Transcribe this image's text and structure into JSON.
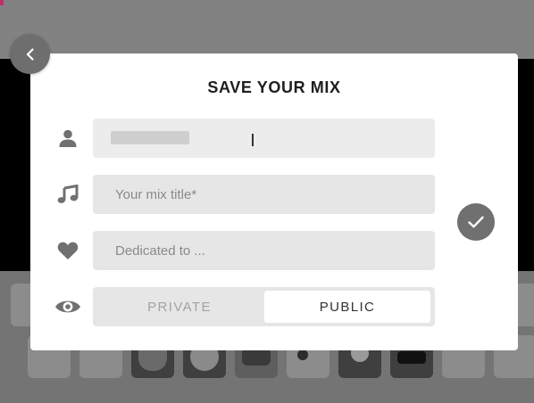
{
  "modal": {
    "title": "SAVE YOUR MIX",
    "name_field": {
      "value": ""
    },
    "title_field": {
      "placeholder": "Your mix title*"
    },
    "dedicated_field": {
      "placeholder": "Dedicated to ..."
    },
    "visibility": {
      "options": [
        "PRIVATE",
        "PUBLIC"
      ],
      "selected": "PUBLIC"
    }
  },
  "icons": {
    "back": "chevron-left-icon",
    "user": "user-icon",
    "music": "music-note-icon",
    "heart": "heart-icon",
    "eye": "eye-icon",
    "confirm": "checkmark-icon"
  },
  "colors": {
    "overlay": "#7a7a7a",
    "modal_bg": "#ffffff",
    "field_bg": "#e6e6e6",
    "icon_gray": "#707070",
    "accent": "#c0306a"
  }
}
